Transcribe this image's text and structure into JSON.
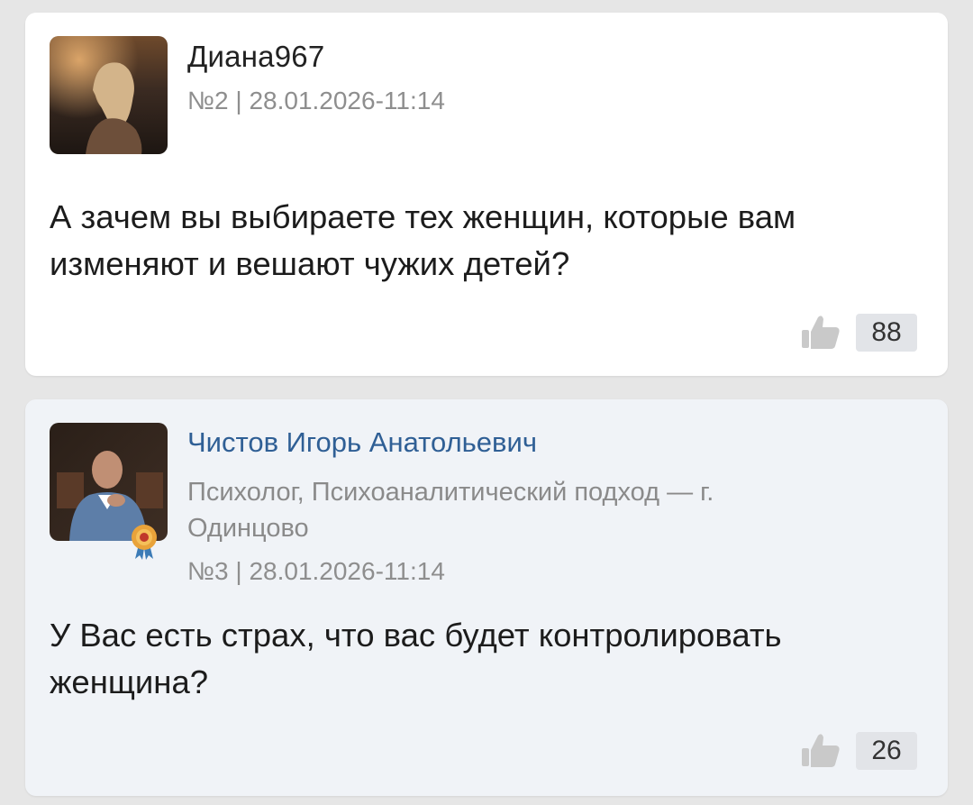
{
  "comments": [
    {
      "author": "Диана967",
      "meta": "№2 | 28.01.2026-11:14",
      "text": "А зачем вы выбираете тех женщин, которые вам изменяют и вешают чужих детей?",
      "likes": "88"
    },
    {
      "author": "Чистов Игорь Анатольевич",
      "description": "Психолог, Психоаналитический подход — г. Одинцово",
      "meta": "№3 | 28.01.2026-11:14",
      "text": "У Вас есть страх, что вас будет контролировать женщина?",
      "likes": "26"
    }
  ],
  "colors": {
    "expert_name": "#2f5f95",
    "meta": "#8e8e8e",
    "card_highlight": "#f0f3f7"
  },
  "icons": {
    "like": "thumbs-up-icon",
    "badge": "expert-badge-icon"
  }
}
